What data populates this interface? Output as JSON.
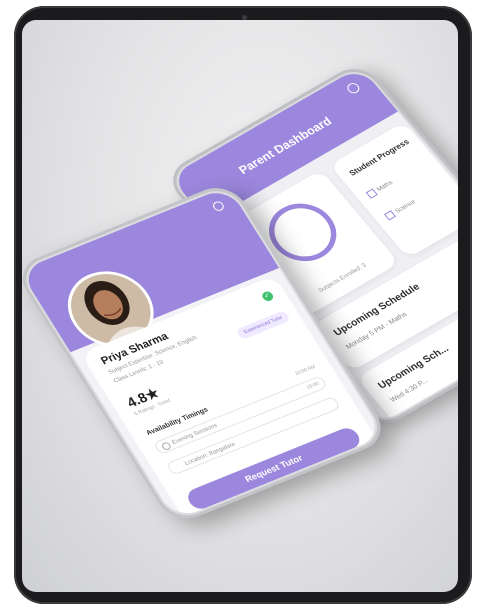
{
  "dashboard": {
    "title": "Parent Dashboard",
    "subjects_label": "Subjects Enrolled: 3",
    "student_progress": {
      "title": "Student Progress",
      "items": [
        "Maths",
        "Science"
      ]
    },
    "upcoming": [
      {
        "title": "Upcoming Schedule",
        "detail": "Monday 5 PM - Maths"
      },
      {
        "title": "Upcoming Sch...",
        "detail": "Wed 4:30 P..."
      }
    ]
  },
  "profile": {
    "name": "Priya Sharma",
    "subjects": "Subject Expertise: Science, English",
    "class_levels": "Class Levels: 1 - 10",
    "badge": "Experienced Tutor",
    "rating": "4.8★",
    "rating_sub": "5 Ratings · Good",
    "availability_title": "Availability Timings",
    "availability_value": "10:00 AM",
    "timing_field": "Evening Sessions",
    "timing_value": "10:00",
    "location": "Location: Bangalore",
    "request_button": "Request Tutor"
  },
  "colors": {
    "accent": "#9b87dd",
    "success": "#3fc06a"
  }
}
